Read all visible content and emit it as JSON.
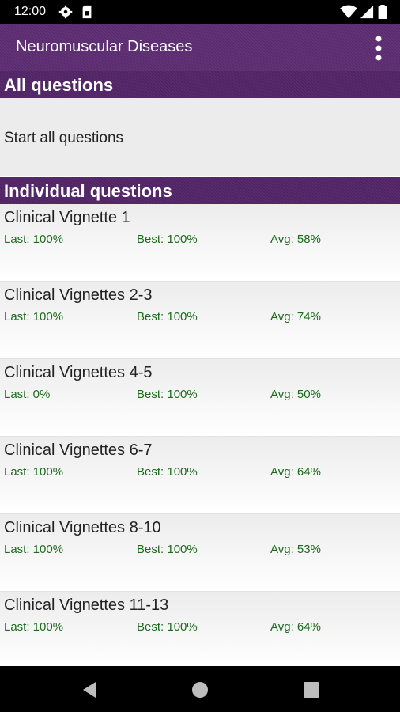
{
  "status_bar": {
    "time": "12:00"
  },
  "app_bar": {
    "title": "Neuromuscular Diseases"
  },
  "sections": {
    "all_title": "All questions",
    "start_all_label": "Start all questions",
    "individual_title": "Individual questions"
  },
  "items": [
    {
      "title": "Clinical Vignette 1",
      "last": "Last: 100%",
      "best": "Best: 100%",
      "avg": "Avg: 58%"
    },
    {
      "title": "Clinical Vignettes 2-3",
      "last": "Last: 100%",
      "best": "Best: 100%",
      "avg": "Avg: 74%"
    },
    {
      "title": "Clinical Vignettes 4-5",
      "last": "Last: 0%",
      "best": "Best: 100%",
      "avg": "Avg: 50%"
    },
    {
      "title": "Clinical Vignettes 6-7",
      "last": "Last: 100%",
      "best": "Best: 100%",
      "avg": "Avg: 64%"
    },
    {
      "title": "Clinical Vignettes 8-10",
      "last": "Last: 100%",
      "best": "Best: 100%",
      "avg": "Avg: 53%"
    },
    {
      "title": "Clinical Vignettes 11-13",
      "last": "Last: 100%",
      "best": "Best: 100%",
      "avg": "Avg: 64%"
    }
  ],
  "colors": {
    "accent": "#5a2a6f",
    "stat_green": "#1c6b1c"
  }
}
